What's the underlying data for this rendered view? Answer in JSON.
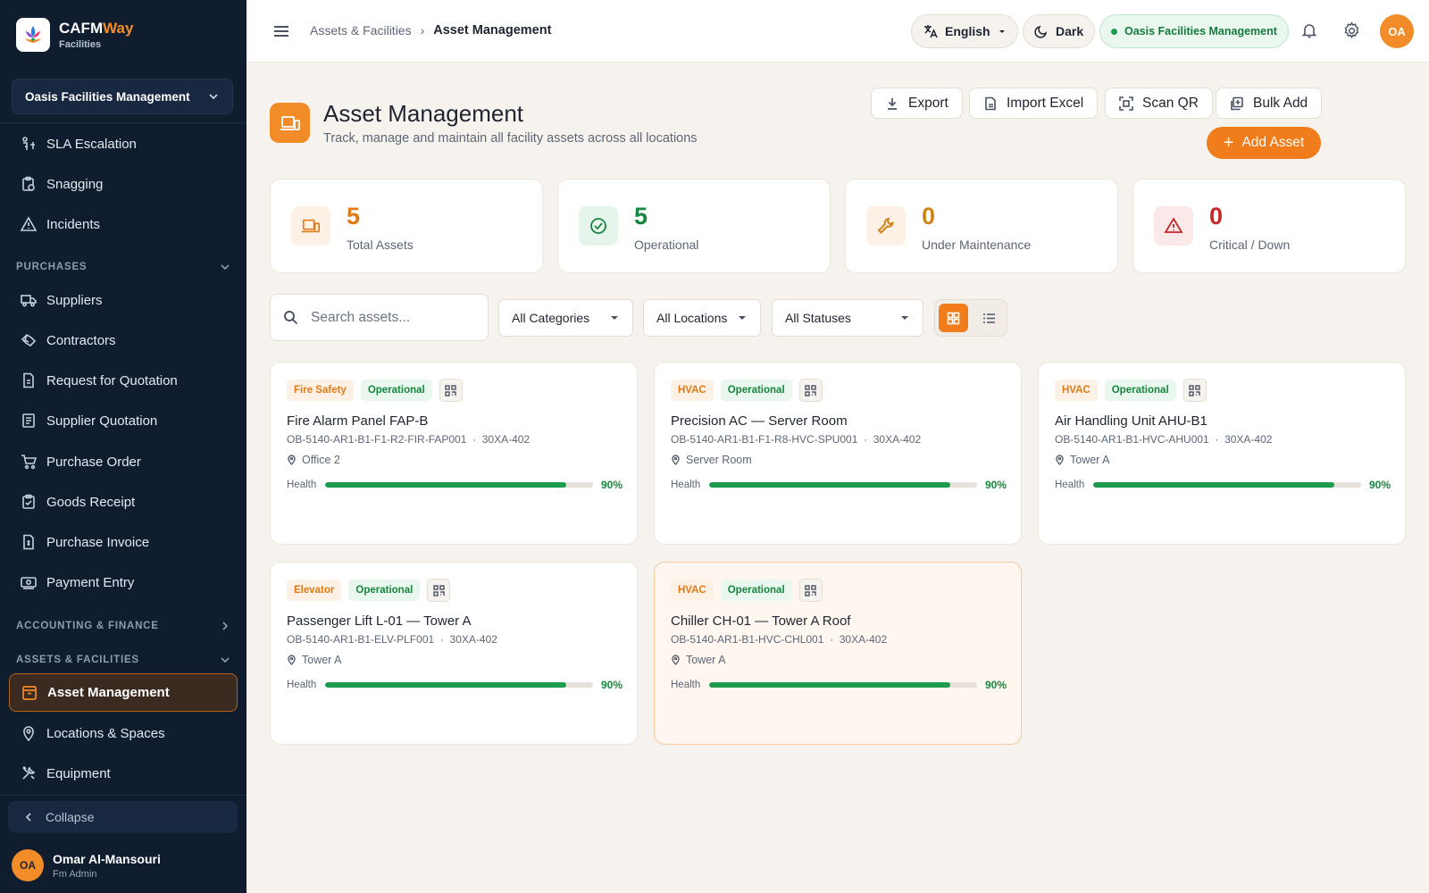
{
  "sidebar": {
    "brand_name_1": "CAFM",
    "brand_name_2": "Way",
    "brand_sub": "Facilities",
    "org": "Oasis Facilities Management",
    "items": [
      {
        "label": "SLA Escalation",
        "icon": "sla-escalation-icon"
      },
      {
        "label": "Snagging",
        "icon": "clipboard-icon"
      },
      {
        "label": "Incidents",
        "icon": "warning-icon"
      },
      {
        "label": "Suppliers",
        "icon": "truck-icon"
      },
      {
        "label": "Contractors",
        "icon": "handshake-icon"
      },
      {
        "label": "Request for Quotation",
        "icon": "document-icon"
      },
      {
        "label": "Supplier Quotation",
        "icon": "receipt-icon"
      },
      {
        "label": "Purchase Order",
        "icon": "cart-icon"
      },
      {
        "label": "Goods Receipt",
        "icon": "clipboard-check-icon"
      },
      {
        "label": "Purchase Invoice",
        "icon": "invoice-icon"
      },
      {
        "label": "Payment Entry",
        "icon": "payment-icon"
      },
      {
        "label": "Asset Management",
        "icon": "archive-icon"
      },
      {
        "label": "Locations & Spaces",
        "icon": "location-pin-icon"
      },
      {
        "label": "Equipment",
        "icon": "tools-icon"
      }
    ],
    "sections": {
      "purchases": "PURCHASES",
      "accounting": "ACCOUNTING & FINANCE",
      "assets": "ASSETS & FACILITIES"
    },
    "collapse_label": "Collapse",
    "user": {
      "initials": "OA",
      "name": "Omar Al-Mansouri",
      "role": "Fm Admin"
    }
  },
  "header": {
    "breadcrumb_parent": "Assets & Facilities",
    "breadcrumb_current": "Asset Management",
    "language": "English",
    "theme": "Dark",
    "org_status": "Oasis Facilities Management",
    "avatar_initials": "OA"
  },
  "page": {
    "title": "Asset Management",
    "subtitle": "Track, manage and maintain all facility assets across all locations",
    "actions": {
      "export": "Export",
      "import": "Import Excel",
      "scan": "Scan QR",
      "bulk": "Bulk Add",
      "add": "Add Asset"
    }
  },
  "stats": [
    {
      "value": "5",
      "label": "Total Assets",
      "color": "#e07a16",
      "bg": "#fdf1e5"
    },
    {
      "value": "5",
      "label": "Operational",
      "color": "#17863f",
      "bg": "#e6f5ec"
    },
    {
      "value": "0",
      "label": "Under Maintenance",
      "color": "#d08417",
      "bg": "#fdf1e5"
    },
    {
      "value": "0",
      "label": "Critical / Down",
      "color": "#c62828",
      "bg": "#fbe9e9"
    }
  ],
  "filters": {
    "search_placeholder": "Search assets...",
    "category": "All Categories",
    "location": "All Locations",
    "status": "All Statuses"
  },
  "assets": [
    {
      "category": "Fire Safety",
      "status": "Operational",
      "name": "Fire Alarm Panel FAP-B",
      "code": "OB-5140-AR1-B1-F1-R2-FIR-FAP001",
      "ref": "30XA-402",
      "location": "Office 2",
      "health_label": "Health",
      "health": 90,
      "health_text": "90%"
    },
    {
      "category": "HVAC",
      "status": "Operational",
      "name": "Precision AC — Server Room",
      "code": "OB-5140-AR1-B1-F1-R8-HVC-SPU001",
      "ref": "30XA-402",
      "location": "Server Room",
      "health_label": "Health",
      "health": 90,
      "health_text": "90%"
    },
    {
      "category": "HVAC",
      "status": "Operational",
      "name": "Air Handling Unit AHU-B1",
      "code": "OB-5140-AR1-B1-HVC-AHU001",
      "ref": "30XA-402",
      "location": "Tower A",
      "health_label": "Health",
      "health": 90,
      "health_text": "90%"
    },
    {
      "category": "Elevator",
      "status": "Operational",
      "name": "Passenger Lift L-01 — Tower A",
      "code": "OB-5140-AR1-B1-ELV-PLF001",
      "ref": "30XA-402",
      "location": "Tower A",
      "health_label": "Health",
      "health": 90,
      "health_text": "90%"
    },
    {
      "category": "HVAC",
      "status": "Operational",
      "name": "Chiller CH-01 — Tower A Roof",
      "code": "OB-5140-AR1-B1-HVC-CHL001",
      "ref": "30XA-402",
      "location": "Tower A",
      "health_label": "Health",
      "health": 90,
      "health_text": "90%"
    }
  ],
  "colors": {
    "accent": "#f07c1b",
    "sidebar_bg": "#101d2f",
    "success": "#1e9c4e"
  }
}
